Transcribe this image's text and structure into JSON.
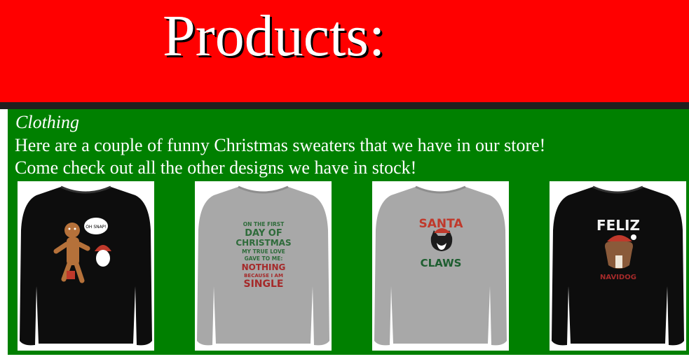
{
  "header": {
    "title": "Products:",
    "color": "#ff0000"
  },
  "section": {
    "category": "Clothing",
    "description_line1": "Here are a couple of funny Christmas sweaters that we have in our store!",
    "description_line2": "Come check out all the other designs we have in stock!",
    "color": "#008000"
  },
  "products": [
    {
      "icon": "gingerbread-sweater-image",
      "sweater_color": "#0d0d0d",
      "print_text": [
        "OH SNAP!"
      ]
    },
    {
      "icon": "first-day-of-christmas-sweater-image",
      "sweater_color": "#a8a8a8",
      "print_text": [
        "ON THE FIRST",
        "DAY OF",
        "CHRISTMAS",
        "MY TRUE LOVE",
        "GAVE TO ME:",
        "NOTHING",
        "BECAUSE I AM",
        "SINGLE"
      ]
    },
    {
      "icon": "santa-claws-sweater-image",
      "sweater_color": "#a8a8a8",
      "print_text": [
        "SANTA",
        "CLAWS"
      ]
    },
    {
      "icon": "feliz-navidog-sweater-image",
      "sweater_color": "#0d0d0d",
      "print_text": [
        "FELIZ",
        "NAVIDOG"
      ]
    }
  ]
}
